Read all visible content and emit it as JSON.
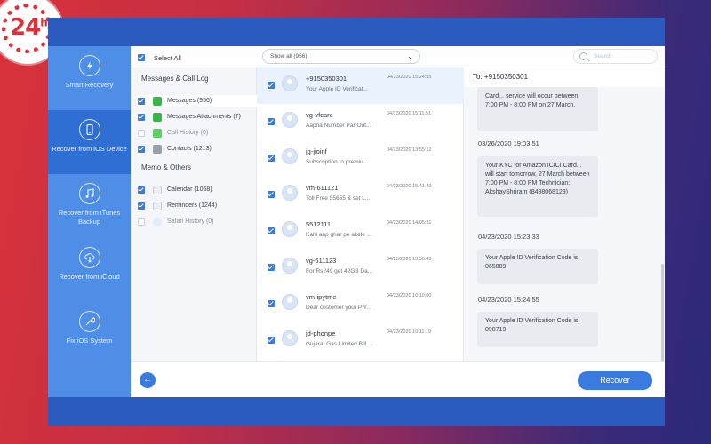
{
  "logo": {
    "text": "24",
    "sup": "h",
    "reg": "®"
  },
  "sidebar": {
    "items": [
      {
        "label": "Smart Recovery",
        "icon": "lightning-refresh-icon",
        "active": false
      },
      {
        "label": "Recover from iOS Device",
        "icon": "phone-icon",
        "active": true
      },
      {
        "label": "Recover from iTunes Backup",
        "icon": "music-note-icon",
        "active": false
      },
      {
        "label": "Recover from iCloud",
        "icon": "cloud-download-icon",
        "active": false
      },
      {
        "label": "Fix iOS System",
        "icon": "wrench-icon",
        "active": false
      }
    ]
  },
  "header": {
    "select_all": "Select All",
    "filter": "Show all (956)",
    "search_placeholder": "Search"
  },
  "categories": {
    "group1_title": "Messages & Call Log",
    "group1": [
      {
        "label": "Messages (956)",
        "checked": true,
        "selected": true,
        "icon_color": "#39b54a",
        "dim": false
      },
      {
        "label": "Messages Attachments (7)",
        "checked": true,
        "selected": false,
        "icon_color": "#39b54a",
        "dim": false
      },
      {
        "label": "Call History (0)",
        "checked": false,
        "selected": false,
        "icon_color": "#5fcf66",
        "dim": true
      },
      {
        "label": "Contacts (1213)",
        "checked": true,
        "selected": false,
        "icon_color": "#9aa1ab",
        "dim": false
      }
    ],
    "group2_title": "Memo & Others",
    "group2": [
      {
        "label": "Calendar (1068)",
        "checked": true,
        "icon_color": "#e9eef5",
        "dim": false
      },
      {
        "label": "Reminders (1244)",
        "checked": true,
        "icon_color": "#e9eef5",
        "dim": false
      },
      {
        "label": "Safari History (0)",
        "checked": false,
        "icon_color": "#e0ecfb",
        "dim": true
      }
    ]
  },
  "messages": [
    {
      "from": "+9150350301",
      "snippet": "Your Apple ID Verificat...",
      "date": "04/23/2020 15:24:55",
      "selected": true
    },
    {
      "from": "vg-vfcare",
      "snippet": "Aapna Number Par Out...",
      "date": "04/23/2020 15:11:51",
      "selected": false
    },
    {
      "from": "jg-jioinf",
      "snippet": "Subscription to premiu...",
      "date": "04/23/2020 13:55:12",
      "selected": false
    },
    {
      "from": "vm-611121",
      "snippet": "Toll Free 55655 & set L...",
      "date": "04/23/2020 15:41:40",
      "selected": false
    },
    {
      "from": "5512111",
      "snippet": "Kahi aap ghar pe akele ...",
      "date": "04/23/2020 14:05:31",
      "selected": false
    },
    {
      "from": "vg-611123",
      "snippet": "For Rs249 get 42GB Da...",
      "date": "04/23/2020 13:56:43",
      "selected": false
    },
    {
      "from": "vm-ipytme",
      "snippet": "Dear customer your P Y...",
      "date": "04/23/2020 10:10:00",
      "selected": false
    },
    {
      "from": "jd-phonpe",
      "snippet": "Gujarat Gas Limited Bill ...",
      "date": "04/23/2020 10:11:19",
      "selected": false
    }
  ],
  "conversation": {
    "to": "To: +9150350301",
    "bubble1": "Card... service will occur between 7:00 PM - 8:00 PM on 27 March.",
    "stamp1": "03/26/2020 19:03:51",
    "bubble2": "Your KYC for Amazon ICICI Card... will start tomorrow, 27 March between 7:00 PM - 8:00 PM Technician: AkshayShriram (8488068129)",
    "stamp2": "04/23/2020 15:23:33",
    "bubble3": "Your Apple ID Verification Code is: 065089",
    "stamp3": "04/23/2020 15:24:55",
    "bubble4": "Your Apple ID Verification Code is: 098719"
  },
  "footer": {
    "back": "←",
    "recover": "Recover"
  }
}
